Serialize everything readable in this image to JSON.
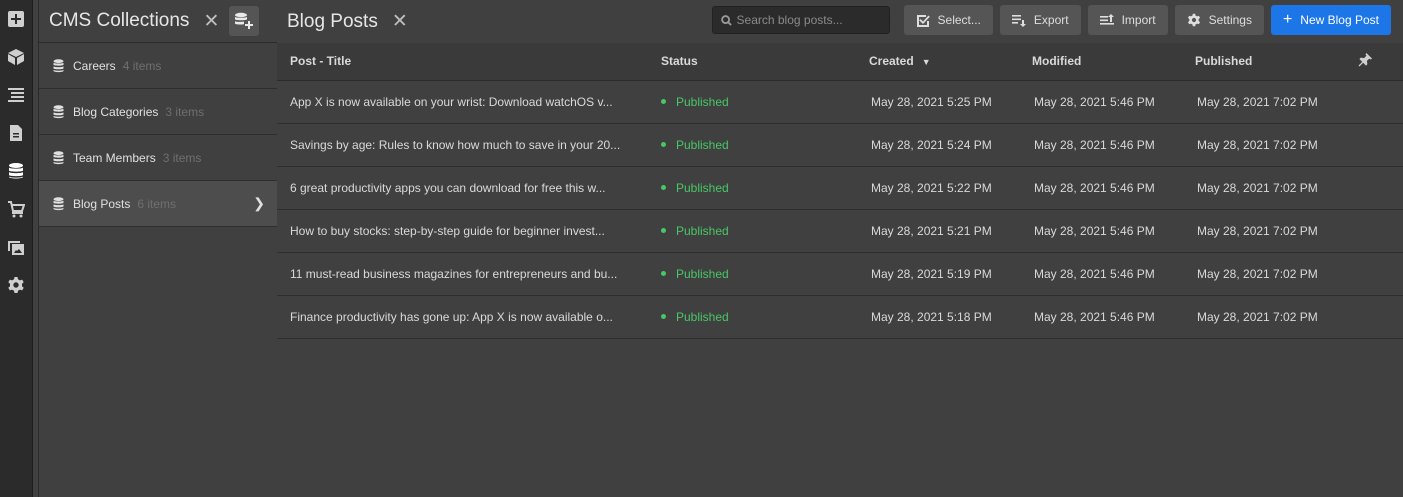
{
  "colors": {
    "accent": "#1d76e8",
    "published": "#47c766",
    "bg": "#404040",
    "rail": "#2b2b2b"
  },
  "rail": {
    "items": [
      {
        "icon": "add-panel-icon"
      },
      {
        "icon": "box-icon"
      },
      {
        "icon": "navigator-icon"
      },
      {
        "icon": "pages-icon"
      },
      {
        "icon": "cms-database-icon",
        "active": true
      },
      {
        "icon": "ecommerce-cart-icon"
      },
      {
        "icon": "assets-icon"
      },
      {
        "icon": "settings-gear-icon"
      }
    ]
  },
  "collections": {
    "title": "CMS Collections",
    "items": [
      {
        "name": "Careers",
        "count": "4 items"
      },
      {
        "name": "Blog Categories",
        "count": "3 items"
      },
      {
        "name": "Team Members",
        "count": "3 items"
      },
      {
        "name": "Blog Posts",
        "count": "6 items",
        "selected": true
      }
    ]
  },
  "main": {
    "title": "Blog Posts",
    "search_placeholder": "Search blog posts...",
    "buttons": {
      "select": "Select...",
      "export": "Export",
      "import": "Import",
      "settings": "Settings",
      "new_post": "New Blog Post"
    },
    "columns": {
      "title": "Post - Title",
      "status": "Status",
      "created": "Created",
      "modified": "Modified",
      "published": "Published"
    },
    "rows": [
      {
        "title": "App X is now available on your wrist: Download watchOS v...",
        "status": "Published",
        "created": "May 28, 2021 5:25 PM",
        "modified": "May 28, 2021 5:46 PM",
        "published": "May 28, 2021 7:02 PM"
      },
      {
        "title": "Savings by age: Rules to know how much to save in your 20...",
        "status": "Published",
        "created": "May 28, 2021 5:24 PM",
        "modified": "May 28, 2021 5:46 PM",
        "published": "May 28, 2021 7:02 PM"
      },
      {
        "title": "6 great productivity apps you can download for free this w...",
        "status": "Published",
        "created": "May 28, 2021 5:22 PM",
        "modified": "May 28, 2021 5:46 PM",
        "published": "May 28, 2021 7:02 PM"
      },
      {
        "title": "How to buy stocks: step-by-step guide for beginner invest...",
        "status": "Published",
        "created": "May 28, 2021 5:21 PM",
        "modified": "May 28, 2021 5:46 PM",
        "published": "May 28, 2021 7:02 PM"
      },
      {
        "title": "11 must-read business magazines for entrepreneurs and bu...",
        "status": "Published",
        "created": "May 28, 2021 5:19 PM",
        "modified": "May 28, 2021 5:46 PM",
        "published": "May 28, 2021 7:02 PM"
      },
      {
        "title": "Finance productivity has gone up: App X is now available o...",
        "status": "Published",
        "created": "May 28, 2021 5:18 PM",
        "modified": "May 28, 2021 5:46 PM",
        "published": "May 28, 2021 7:02 PM"
      }
    ]
  }
}
